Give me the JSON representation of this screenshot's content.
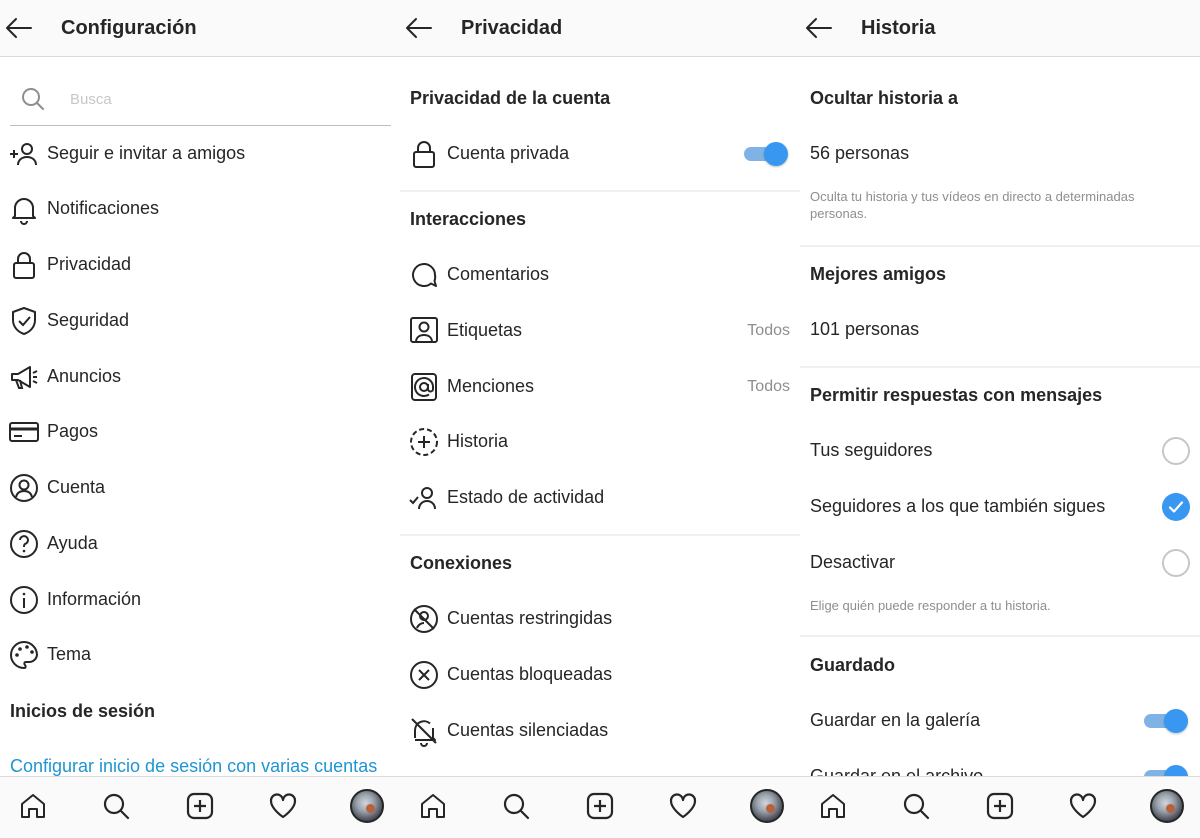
{
  "panels": {
    "configuracion": {
      "title": "Configuración",
      "search_placeholder": "Busca",
      "items": [
        {
          "label": "Seguir e invitar a amigos",
          "icon": "add-user-icon"
        },
        {
          "label": "Notificaciones",
          "icon": "bell-icon"
        },
        {
          "label": "Privacidad",
          "icon": "lock-icon"
        },
        {
          "label": "Seguridad",
          "icon": "shield-icon"
        },
        {
          "label": "Anuncios",
          "icon": "megaphone-icon"
        },
        {
          "label": "Pagos",
          "icon": "credit-card-icon"
        },
        {
          "label": "Cuenta",
          "icon": "account-icon"
        },
        {
          "label": "Ayuda",
          "icon": "help-icon"
        },
        {
          "label": "Información",
          "icon": "info-icon"
        },
        {
          "label": "Tema",
          "icon": "palette-icon"
        }
      ],
      "section_logins": "Inicios de sesión",
      "multi_account_link": "Configurar inicio de sesión con varias cuentas"
    },
    "privacidad": {
      "title": "Privacidad",
      "section_account": "Privacidad de la cuenta",
      "private_account": {
        "label": "Cuenta privada",
        "enabled": true
      },
      "section_interactions": "Interacciones",
      "interactions": [
        {
          "label": "Comentarios",
          "icon": "comment-icon",
          "value": ""
        },
        {
          "label": "Etiquetas",
          "icon": "tag-person-icon",
          "value": "Todos"
        },
        {
          "label": "Menciones",
          "icon": "at-sign-icon",
          "value": "Todos"
        },
        {
          "label": "Historia",
          "icon": "story-add-icon",
          "value": ""
        },
        {
          "label": "Estado de actividad",
          "icon": "activity-status-icon",
          "value": ""
        }
      ],
      "section_connections": "Conexiones",
      "connections": [
        {
          "label": "Cuentas restringidas",
          "icon": "restricted-icon"
        },
        {
          "label": "Cuentas bloqueadas",
          "icon": "blocked-icon"
        },
        {
          "label": "Cuentas silenciadas",
          "icon": "muted-icon"
        }
      ]
    },
    "historia": {
      "title": "Historia",
      "section_hide": "Ocultar historia a",
      "hide_count": "56 personas",
      "hide_desc": "Oculta tu historia y tus vídeos en directo a determinadas personas.",
      "section_close_friends": "Mejores amigos",
      "close_friends_count": "101 personas",
      "section_replies": "Permitir respuestas con mensajes",
      "reply_options": [
        {
          "label": "Tus seguidores",
          "selected": false
        },
        {
          "label": "Seguidores a los que también sigues",
          "selected": true
        },
        {
          "label": "Desactivar",
          "selected": false
        }
      ],
      "replies_desc": "Elige quién puede responder a tu historia.",
      "section_saved": "Guardado",
      "save_gallery": {
        "label": "Guardar en la galería",
        "enabled": true
      },
      "save_archive": {
        "label": "Guardar en el archivo",
        "enabled": true
      }
    }
  },
  "bottom_nav": [
    "home-icon",
    "search-icon",
    "new-post-icon",
    "heart-icon",
    "profile-avatar"
  ],
  "colors": {
    "accent": "#3897f0",
    "link": "#1e95d4",
    "muted": "#8e8e8e",
    "text": "#262626"
  }
}
